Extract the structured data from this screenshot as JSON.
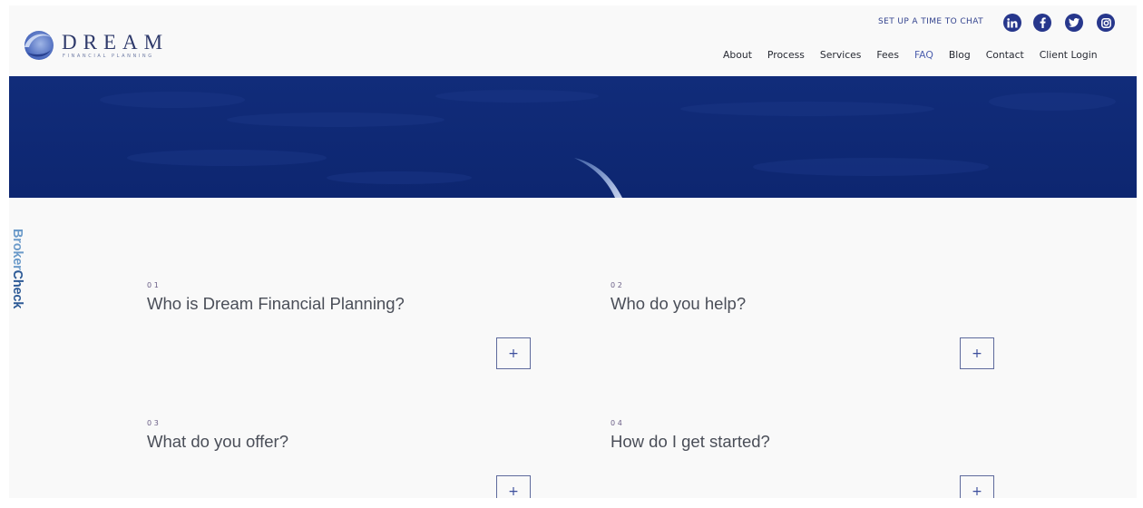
{
  "brand": {
    "name": "DREAM",
    "tagline": "FINANCIAL PLANNING"
  },
  "header": {
    "chat_link": "SET UP A TIME TO CHAT",
    "social": [
      "linkedin-icon",
      "facebook-icon",
      "twitter-icon",
      "instagram-icon"
    ]
  },
  "nav": {
    "items": [
      {
        "label": "About"
      },
      {
        "label": "Process"
      },
      {
        "label": "Services"
      },
      {
        "label": "Fees"
      },
      {
        "label": "FAQ",
        "active": true
      },
      {
        "label": "Blog"
      },
      {
        "label": "Contact"
      },
      {
        "label": "Client Login"
      }
    ]
  },
  "sidebar_badge": {
    "part1": "Broker",
    "part2": "Check"
  },
  "faq": {
    "items": [
      {
        "number": "01",
        "question": "Who is Dream Financial Planning?",
        "toggle": "+"
      },
      {
        "number": "02",
        "question": "Who do you help?",
        "toggle": "+"
      },
      {
        "number": "03",
        "question": "What do you offer?",
        "toggle": "+"
      },
      {
        "number": "04",
        "question": "How do I get started?",
        "toggle": "+"
      }
    ]
  },
  "colors": {
    "brand_navy": "#0f2a78",
    "accent_blue": "#27378c",
    "nav_active": "#4d5fae",
    "broker_light": "#6b9ac9",
    "broker_dark": "#2d5a96"
  }
}
